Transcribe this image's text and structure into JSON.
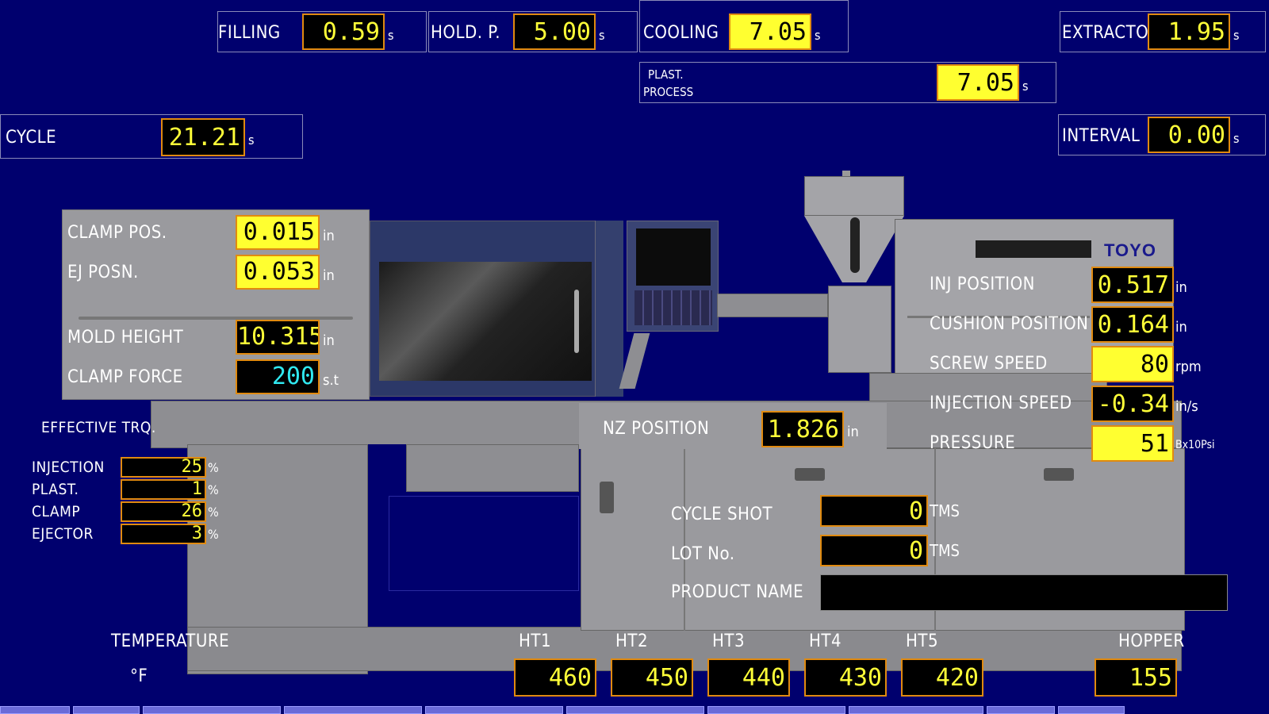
{
  "top": {
    "filling": {
      "label": "FILLING",
      "value": "0.59",
      "unit": "s"
    },
    "hold_p": {
      "label": "HOLD. P.",
      "value": "5.00",
      "unit": "s"
    },
    "cooling": {
      "label": "COOLING",
      "value": "7.05",
      "unit": "s"
    },
    "extractor": {
      "label": "EXTRACTOR",
      "value": "1.95",
      "unit": "s"
    },
    "plast_process": {
      "label1": "PLAST.",
      "label2": "PROCESS",
      "value": "7.05",
      "unit": "s"
    },
    "cycle": {
      "label": "CYCLE",
      "value": "21.21",
      "unit": "s"
    },
    "interval": {
      "label": "INTERVAL",
      "value": "0.00",
      "unit": "s"
    }
  },
  "clamp": {
    "clamp_pos": {
      "label": "CLAMP POS.",
      "value": "0.015",
      "unit": "in"
    },
    "ej_posn": {
      "label": "EJ POSN.",
      "value": "0.053",
      "unit": "in"
    },
    "mold_height": {
      "label": "MOLD HEIGHT",
      "value": "10.315",
      "unit": "in"
    },
    "clamp_force": {
      "label": "CLAMP FORCE",
      "value": "200",
      "unit": "s.t"
    }
  },
  "injection": {
    "brand": "TOYO",
    "inj_position": {
      "label": "INJ POSITION",
      "value": "0.517",
      "unit": "in"
    },
    "cushion_position": {
      "label": "CUSHION POSITION",
      "value": "0.164",
      "unit": "in"
    },
    "screw_speed": {
      "label": "SCREW SPEED",
      "value": "80",
      "unit": "rpm"
    },
    "injection_speed": {
      "label": "INJECTION SPEED",
      "value": "-0.34",
      "unit": "in/s"
    },
    "pressure": {
      "label": "PRESSURE",
      "value": "51",
      "unit": "Bx10Psi"
    }
  },
  "nz_position": {
    "label": "NZ POSITION",
    "value": "1.826",
    "unit": "in"
  },
  "torque": {
    "title": "EFFECTIVE TRQ.",
    "unit": "%",
    "rows": [
      {
        "label": "INJECTION",
        "value": "25"
      },
      {
        "label": "PLAST.",
        "value": "1"
      },
      {
        "label": "CLAMP",
        "value": "26"
      },
      {
        "label": "EJECTOR",
        "value": "3"
      }
    ]
  },
  "counters": {
    "cycle_shot": {
      "label": "CYCLE SHOT",
      "value": "0",
      "unit": "TMS"
    },
    "lot_no": {
      "label": "LOT No.",
      "value": "0",
      "unit": "TMS"
    },
    "product_name": {
      "label": "PRODUCT NAME",
      "value": ""
    }
  },
  "temperature": {
    "title": "TEMPERATURE",
    "unit": "°F",
    "zones": [
      {
        "label": "HT1",
        "value": "460"
      },
      {
        "label": "HT2",
        "value": "450"
      },
      {
        "label": "HT3",
        "value": "440"
      },
      {
        "label": "HT4",
        "value": "430"
      },
      {
        "label": "HT5",
        "value": "420"
      }
    ],
    "hopper": {
      "label": "HOPPER",
      "value": "155"
    }
  },
  "colors": {
    "background": "#00006e",
    "value_text": "#ffff38",
    "highlight": "#ffff30",
    "border": "#e08a10"
  }
}
